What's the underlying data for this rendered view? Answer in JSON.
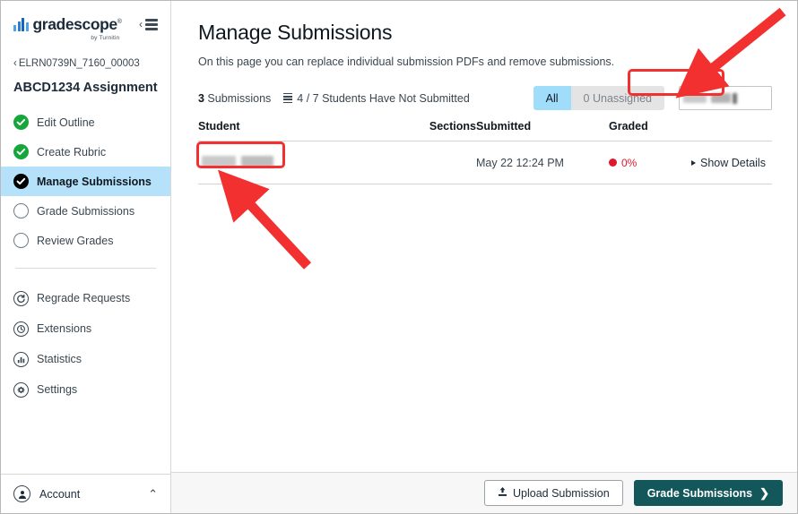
{
  "sidebar": {
    "logo": {
      "name": "gradescope",
      "registered": "®",
      "byline": "by Turnitin"
    },
    "collapse_label": "‹",
    "breadcrumb": {
      "arrow": "‹",
      "label": "ELRN0739N_7160_00003"
    },
    "assignment_title": "ABCD1234 Assignment...",
    "steps": [
      {
        "label": "Edit Outline",
        "state": "done"
      },
      {
        "label": "Create Rubric",
        "state": "done"
      },
      {
        "label": "Manage Submissions",
        "state": "current"
      },
      {
        "label": "Grade Submissions",
        "state": "todo"
      },
      {
        "label": "Review Grades",
        "state": "todo"
      }
    ],
    "links": [
      {
        "label": "Regrade Requests",
        "icon": "regrade-icon"
      },
      {
        "label": "Extensions",
        "icon": "clock-icon"
      },
      {
        "label": "Statistics",
        "icon": "statistics-icon"
      },
      {
        "label": "Settings",
        "icon": "gear-icon"
      }
    ],
    "account": {
      "label": "Account",
      "caret": "⌃"
    }
  },
  "main": {
    "title": "Manage Submissions",
    "description": "On this page you can replace individual submission PDFs and remove submissions.",
    "meta": {
      "count_number": "3",
      "count_label": " Submissions",
      "not_submitted": "4 / 7 Students Have Not Submitted"
    },
    "filters": {
      "all_label": "All",
      "unassigned_label": "0 Unassigned",
      "search_placeholder": "",
      "search_value": ""
    },
    "table": {
      "columns": [
        "Student",
        "Sections",
        "Submitted",
        "Graded",
        ""
      ],
      "rows": [
        {
          "student": "",
          "sections": "",
          "submitted": "May 22 12:24 PM",
          "graded_pct": "0%",
          "details_label": "Show Details"
        }
      ]
    },
    "footer": {
      "upload_label": "Upload Submission",
      "grade_label": "Grade Submissions",
      "grade_chevron": "❯"
    }
  },
  "colors": {
    "accent_blue": "#b5e2fa",
    "toggle_on": "#9fddfb",
    "primary_button": "#14575a",
    "done_green": "#16a63c",
    "graded_red": "#e0182d",
    "annotation_red": "#f23030"
  }
}
